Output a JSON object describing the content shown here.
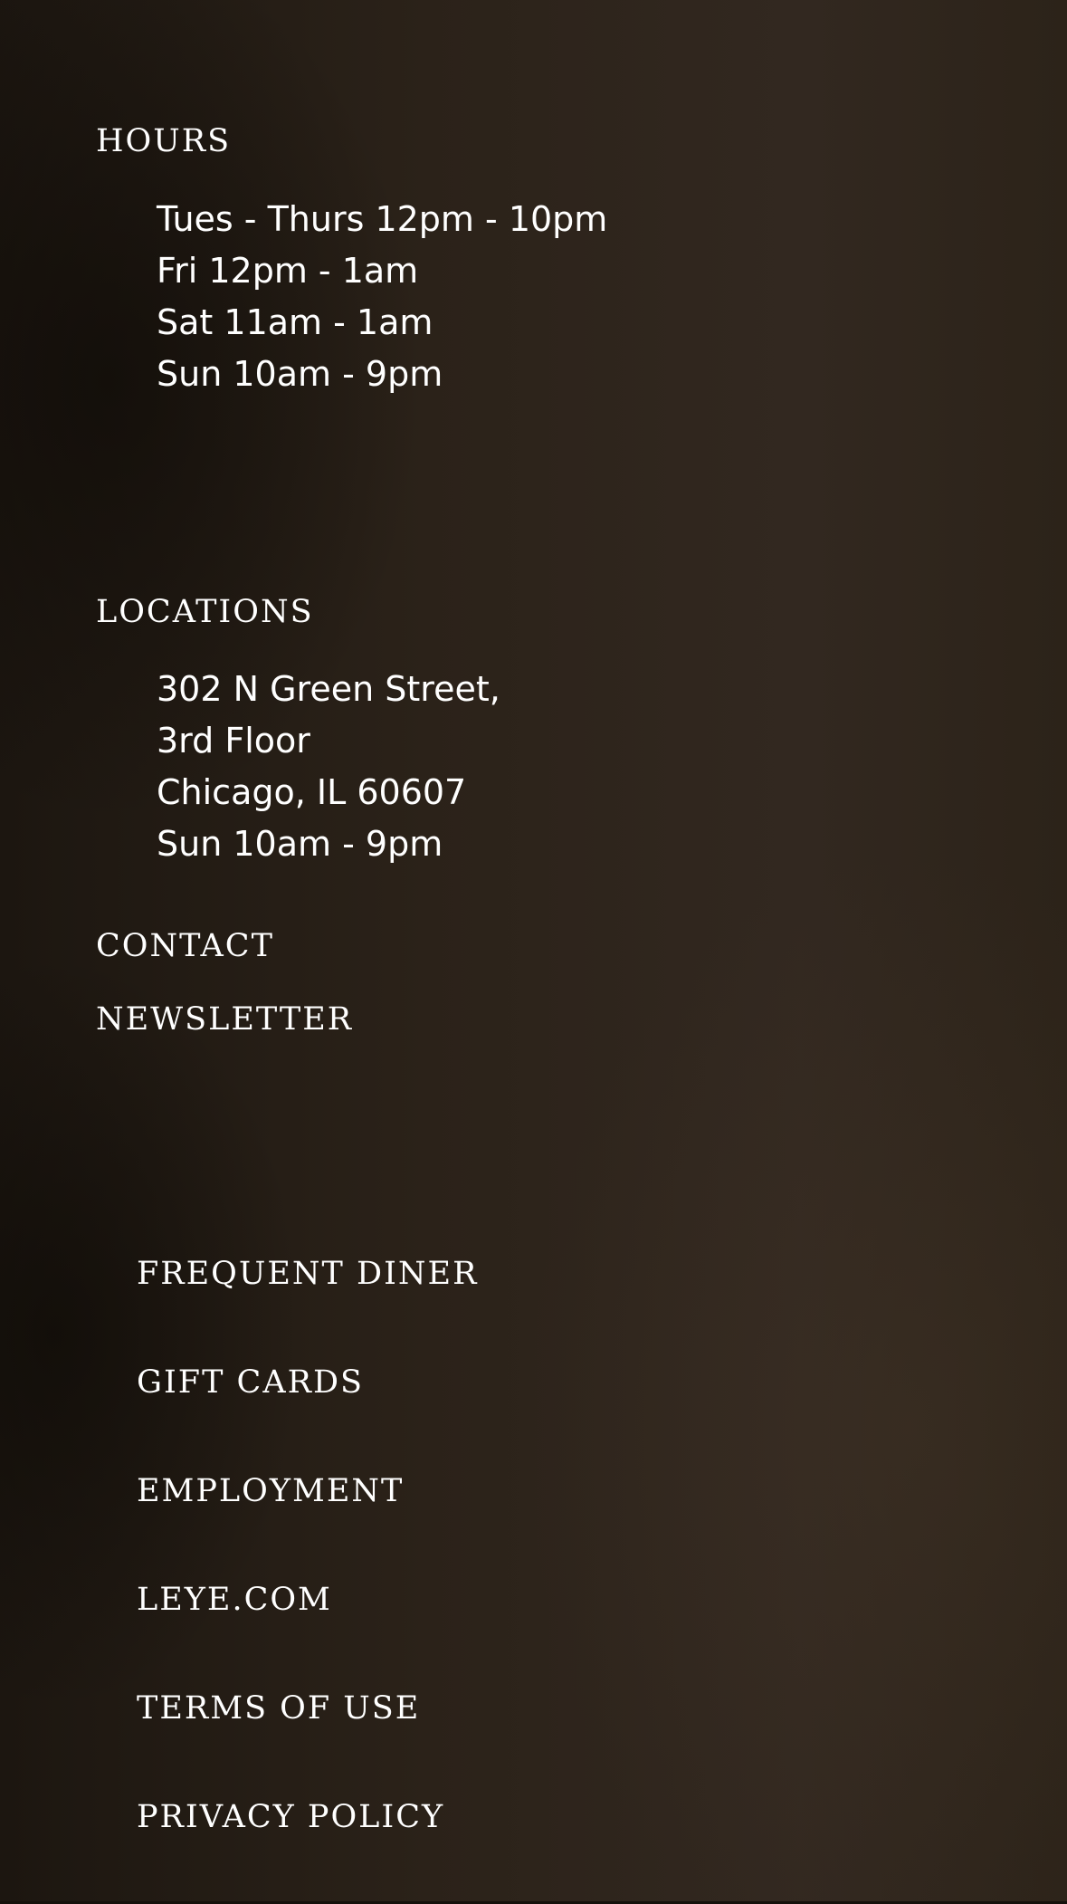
{
  "hours": {
    "title": "HOURS",
    "lines": [
      "Tues - Thurs 12pm - 10pm",
      "Fri 12pm - 1am",
      "Sat 11am - 1am",
      "Sun 10am - 9pm"
    ]
  },
  "locations": {
    "title": "LOCATIONS",
    "lines": [
      "302 N Green Street,",
      "3rd Floor",
      "Chicago, IL 60607",
      "Sun 10am - 9pm"
    ]
  },
  "contact": {
    "label": "CONTACT"
  },
  "newsletter": {
    "label": "NEWSLETTER"
  },
  "footer_links": [
    {
      "label": "FREQUENT DINER"
    },
    {
      "label": "GIFT CARDS"
    },
    {
      "label": "EMPLOYMENT"
    },
    {
      "label": "LEYE.COM"
    },
    {
      "label": "TERMS OF USE"
    },
    {
      "label": "PRIVACY POLICY"
    }
  ],
  "colors": {
    "text": "#ffffff",
    "background": "#2a2118"
  }
}
